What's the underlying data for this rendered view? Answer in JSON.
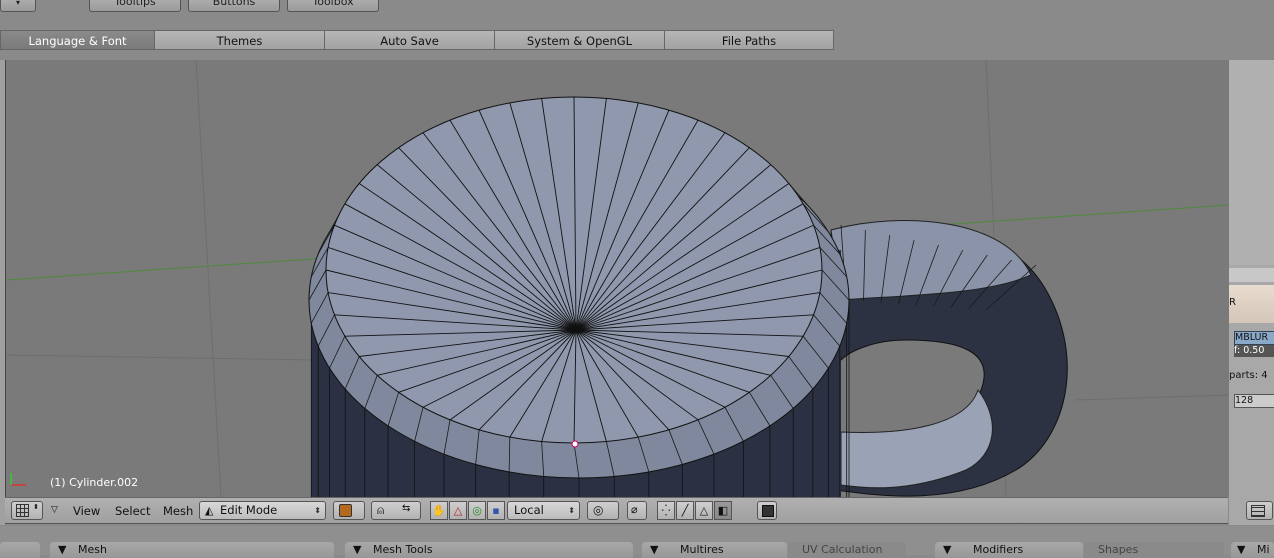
{
  "top_buttons": [
    "Tooltips",
    "Buttons",
    "Toolbox"
  ],
  "prefs_tabs": [
    {
      "label": "Language & Font",
      "active": true
    },
    {
      "label": "Themes",
      "active": false
    },
    {
      "label": "Auto Save",
      "active": false
    },
    {
      "label": "System & OpenGL",
      "active": false
    },
    {
      "label": "File Paths",
      "active": false
    }
  ],
  "viewport": {
    "object_name": "(1) Cylinder.002",
    "background": "#7a7a7a",
    "mesh_top_color": "#8a93a8",
    "mesh_side_color": "#30384a"
  },
  "header": {
    "menus": [
      "View",
      "Select",
      "Mesh"
    ],
    "mode": "Edit Mode",
    "pivot": "Local"
  },
  "right_panel": {
    "label_r": "R",
    "mblur": "MBLUR",
    "factor": "f: 0.50",
    "parts": "parts: 4",
    "value": "128"
  },
  "bottom_panels": [
    "Mesh",
    "Mesh Tools",
    "Multires",
    "UV Calculation",
    "Modifiers",
    "Shapes",
    "Mi"
  ]
}
